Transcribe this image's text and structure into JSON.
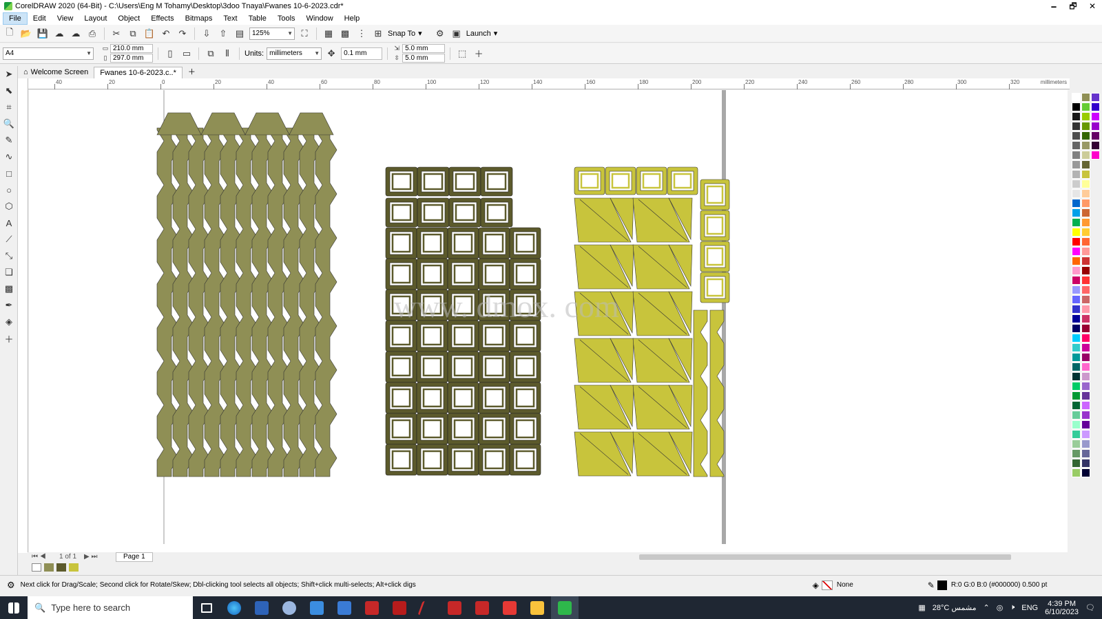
{
  "window": {
    "title": "CorelDRAW 2020 (64-Bit) - C:\\Users\\Eng M Tohamy\\Desktop\\3doo Tnaya\\Fwanes  10-6-2023.cdr*",
    "controls": [
      "🗕",
      "🗗",
      "✕"
    ]
  },
  "menu": [
    "File",
    "Edit",
    "View",
    "Layout",
    "Object",
    "Effects",
    "Bitmaps",
    "Text",
    "Table",
    "Tools",
    "Window",
    "Help"
  ],
  "toolbar1": {
    "zoom": "125%",
    "snap_to": "Snap To",
    "launch": "Launch"
  },
  "toolbar2": {
    "page_size": "A4",
    "width": "210.0 mm",
    "height": "297.0 mm",
    "units_label": "Units:",
    "units_value": "millimeters",
    "nudge": "0.1 mm",
    "dup_x": "5.0 mm",
    "dup_y": "5.0 mm"
  },
  "tabs": {
    "welcome": "Welcome Screen",
    "document": "Fwanes  10-6-2023.c..*"
  },
  "ruler": {
    "h_ticks": [
      "40",
      "20",
      "0",
      "20",
      "40",
      "60",
      "80",
      "100",
      "120",
      "140",
      "160",
      "180",
      "200",
      "220",
      "240",
      "260",
      "280",
      "300",
      "320"
    ],
    "unit": "millimeters"
  },
  "page_nav": {
    "counter": "1 of 1",
    "page_tab": "Page 1"
  },
  "status": {
    "hint": "Next click for Drag/Scale; Second click for Rotate/Skew; Dbl-clicking tool selects all objects; Shift+click multi-selects; Alt+click digs",
    "fill_label": "None",
    "outline_info": "R:0 G:0 B:0 (#000000)  0.500 pt"
  },
  "taskbar": {
    "search_placeholder": "Type here to search",
    "weather": "28°C  مشمس",
    "lang": "ENG",
    "time": "4:39 PM",
    "date": "6/10/2023"
  },
  "watermark": "www.     dmox. com",
  "colors": {
    "shape_olive": "#8f8f55",
    "shape_dark": "#5c5a2c",
    "shape_yellow": "#c8c43c",
    "page_border": "#a8a8a8"
  }
}
